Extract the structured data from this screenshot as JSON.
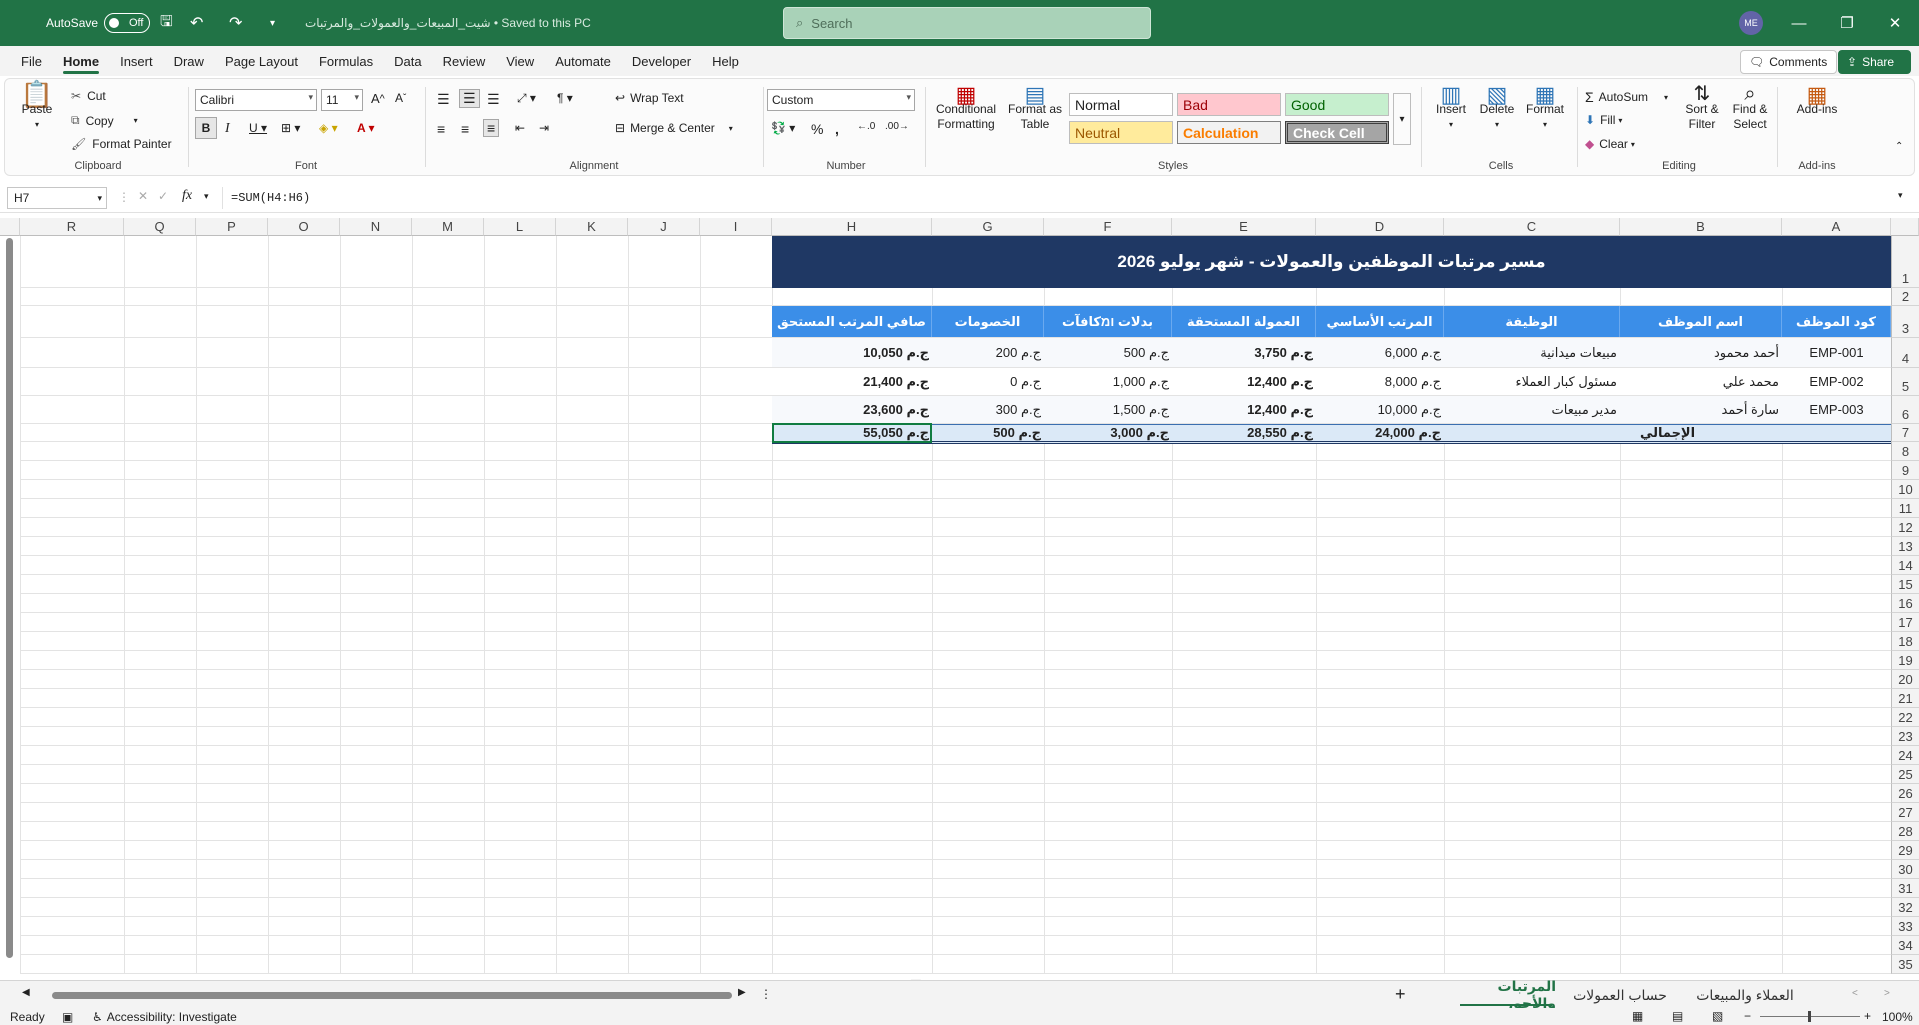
{
  "titlebar": {
    "autosave_label": "AutoSave",
    "autosave_state": "Off",
    "doc_title": "شيت_المبيعات_والعمولات_والمرتبات • Saved to this PC",
    "search_placeholder": "Search",
    "avatar_initials": "ME"
  },
  "menu": {
    "items": [
      "File",
      "Home",
      "Insert",
      "Draw",
      "Page Layout",
      "Formulas",
      "Data",
      "Review",
      "View",
      "Automate",
      "Developer",
      "Help"
    ],
    "active": "Home",
    "comments": "Comments",
    "share": "Share"
  },
  "ribbon": {
    "clipboard": {
      "label": "Clipboard",
      "paste": "Paste",
      "cut": "Cut",
      "copy": "Copy",
      "format_painter": "Format Painter"
    },
    "font": {
      "label": "Font",
      "name": "Calibri",
      "size": "11"
    },
    "alignment": {
      "label": "Alignment",
      "wrap": "Wrap Text",
      "merge": "Merge & Center"
    },
    "number": {
      "label": "Number",
      "format": "Custom"
    },
    "styles": {
      "label": "Styles",
      "conditional": "Conditional Formatting",
      "format_table": "Format as Table",
      "normal": "Normal",
      "bad": "Bad",
      "good": "Good",
      "neutral": "Neutral",
      "calculation": "Calculation",
      "check": "Check Cell"
    },
    "cells": {
      "label": "Cells",
      "insert": "Insert",
      "delete": "Delete",
      "format": "Format"
    },
    "editing": {
      "label": "Editing",
      "autosum": "AutoSum",
      "fill": "Fill",
      "clear": "Clear",
      "sort": "Sort & Filter",
      "find": "Find & Select"
    },
    "addins": {
      "label": "Add-ins",
      "addins": "Add-ins"
    }
  },
  "formula_bar": {
    "name_box": "H7",
    "formula": "=SUM(H4:H6)"
  },
  "columns": [
    "R",
    "Q",
    "P",
    "O",
    "N",
    "M",
    "L",
    "K",
    "J",
    "I",
    "H",
    "G",
    "F",
    "E",
    "D",
    "C",
    "B",
    "A"
  ],
  "rows": [
    "1",
    "2",
    "3",
    "4",
    "5",
    "6",
    "7",
    "8",
    "9",
    "10",
    "11",
    "12",
    "13",
    "14",
    "15",
    "16",
    "17",
    "18",
    "19",
    "20",
    "21",
    "22",
    "23",
    "24",
    "25",
    "26",
    "27",
    "28",
    "29",
    "30",
    "31",
    "32",
    "33",
    "34",
    "35"
  ],
  "table": {
    "title": "مسير مرتبات الموظفين والعمولات - شهر يوليو 2026",
    "headers": [
      "كود الموظف",
      "اسم الموظف",
      "الوظيفة",
      "المرتب الأساسي",
      "العمولة المستحقة",
      "بدلات ומكافآت",
      "الخصومات",
      "صافي المرتب المستحق"
    ],
    "rows": [
      [
        "EMP-001",
        "أحمد محمود",
        "مبيعات ميدانية",
        "ج.م 6,000",
        "ج.م 3,750",
        "ج.م 500",
        "ج.م 200",
        "ج.م 10,050"
      ],
      [
        "EMP-002",
        "محمد علي",
        "مسئول كبار العملاء",
        "ج.م 8,000",
        "ج.م 12,400",
        "ج.م 1,000",
        "ج.م 0",
        "ج.م 21,400"
      ],
      [
        "EMP-003",
        "سارة أحمد",
        "مدير مبيعات",
        "ج.م 10,000",
        "ج.م 12,400",
        "ج.م 1,500",
        "ج.م 300",
        "ج.م 23,600"
      ]
    ],
    "total_label": "الإجمالي",
    "totals": [
      "ج.م 24,000",
      "ج.م 28,550",
      "ج.م 3,000",
      "ج.م 500",
      "ج.م 55,050"
    ]
  },
  "sheet_tabs": [
    "المرتبات والأجور",
    "حساب العمولات",
    "العملاء والمبيعات"
  ],
  "active_tab": "المرتبات والأجور",
  "status": {
    "ready": "Ready",
    "accessibility": "Accessibility: Investigate",
    "zoom": "100%"
  },
  "colors": {
    "title_bg": "#1f3864",
    "header_bg": "#3b8ee8",
    "accent": "#217346"
  }
}
